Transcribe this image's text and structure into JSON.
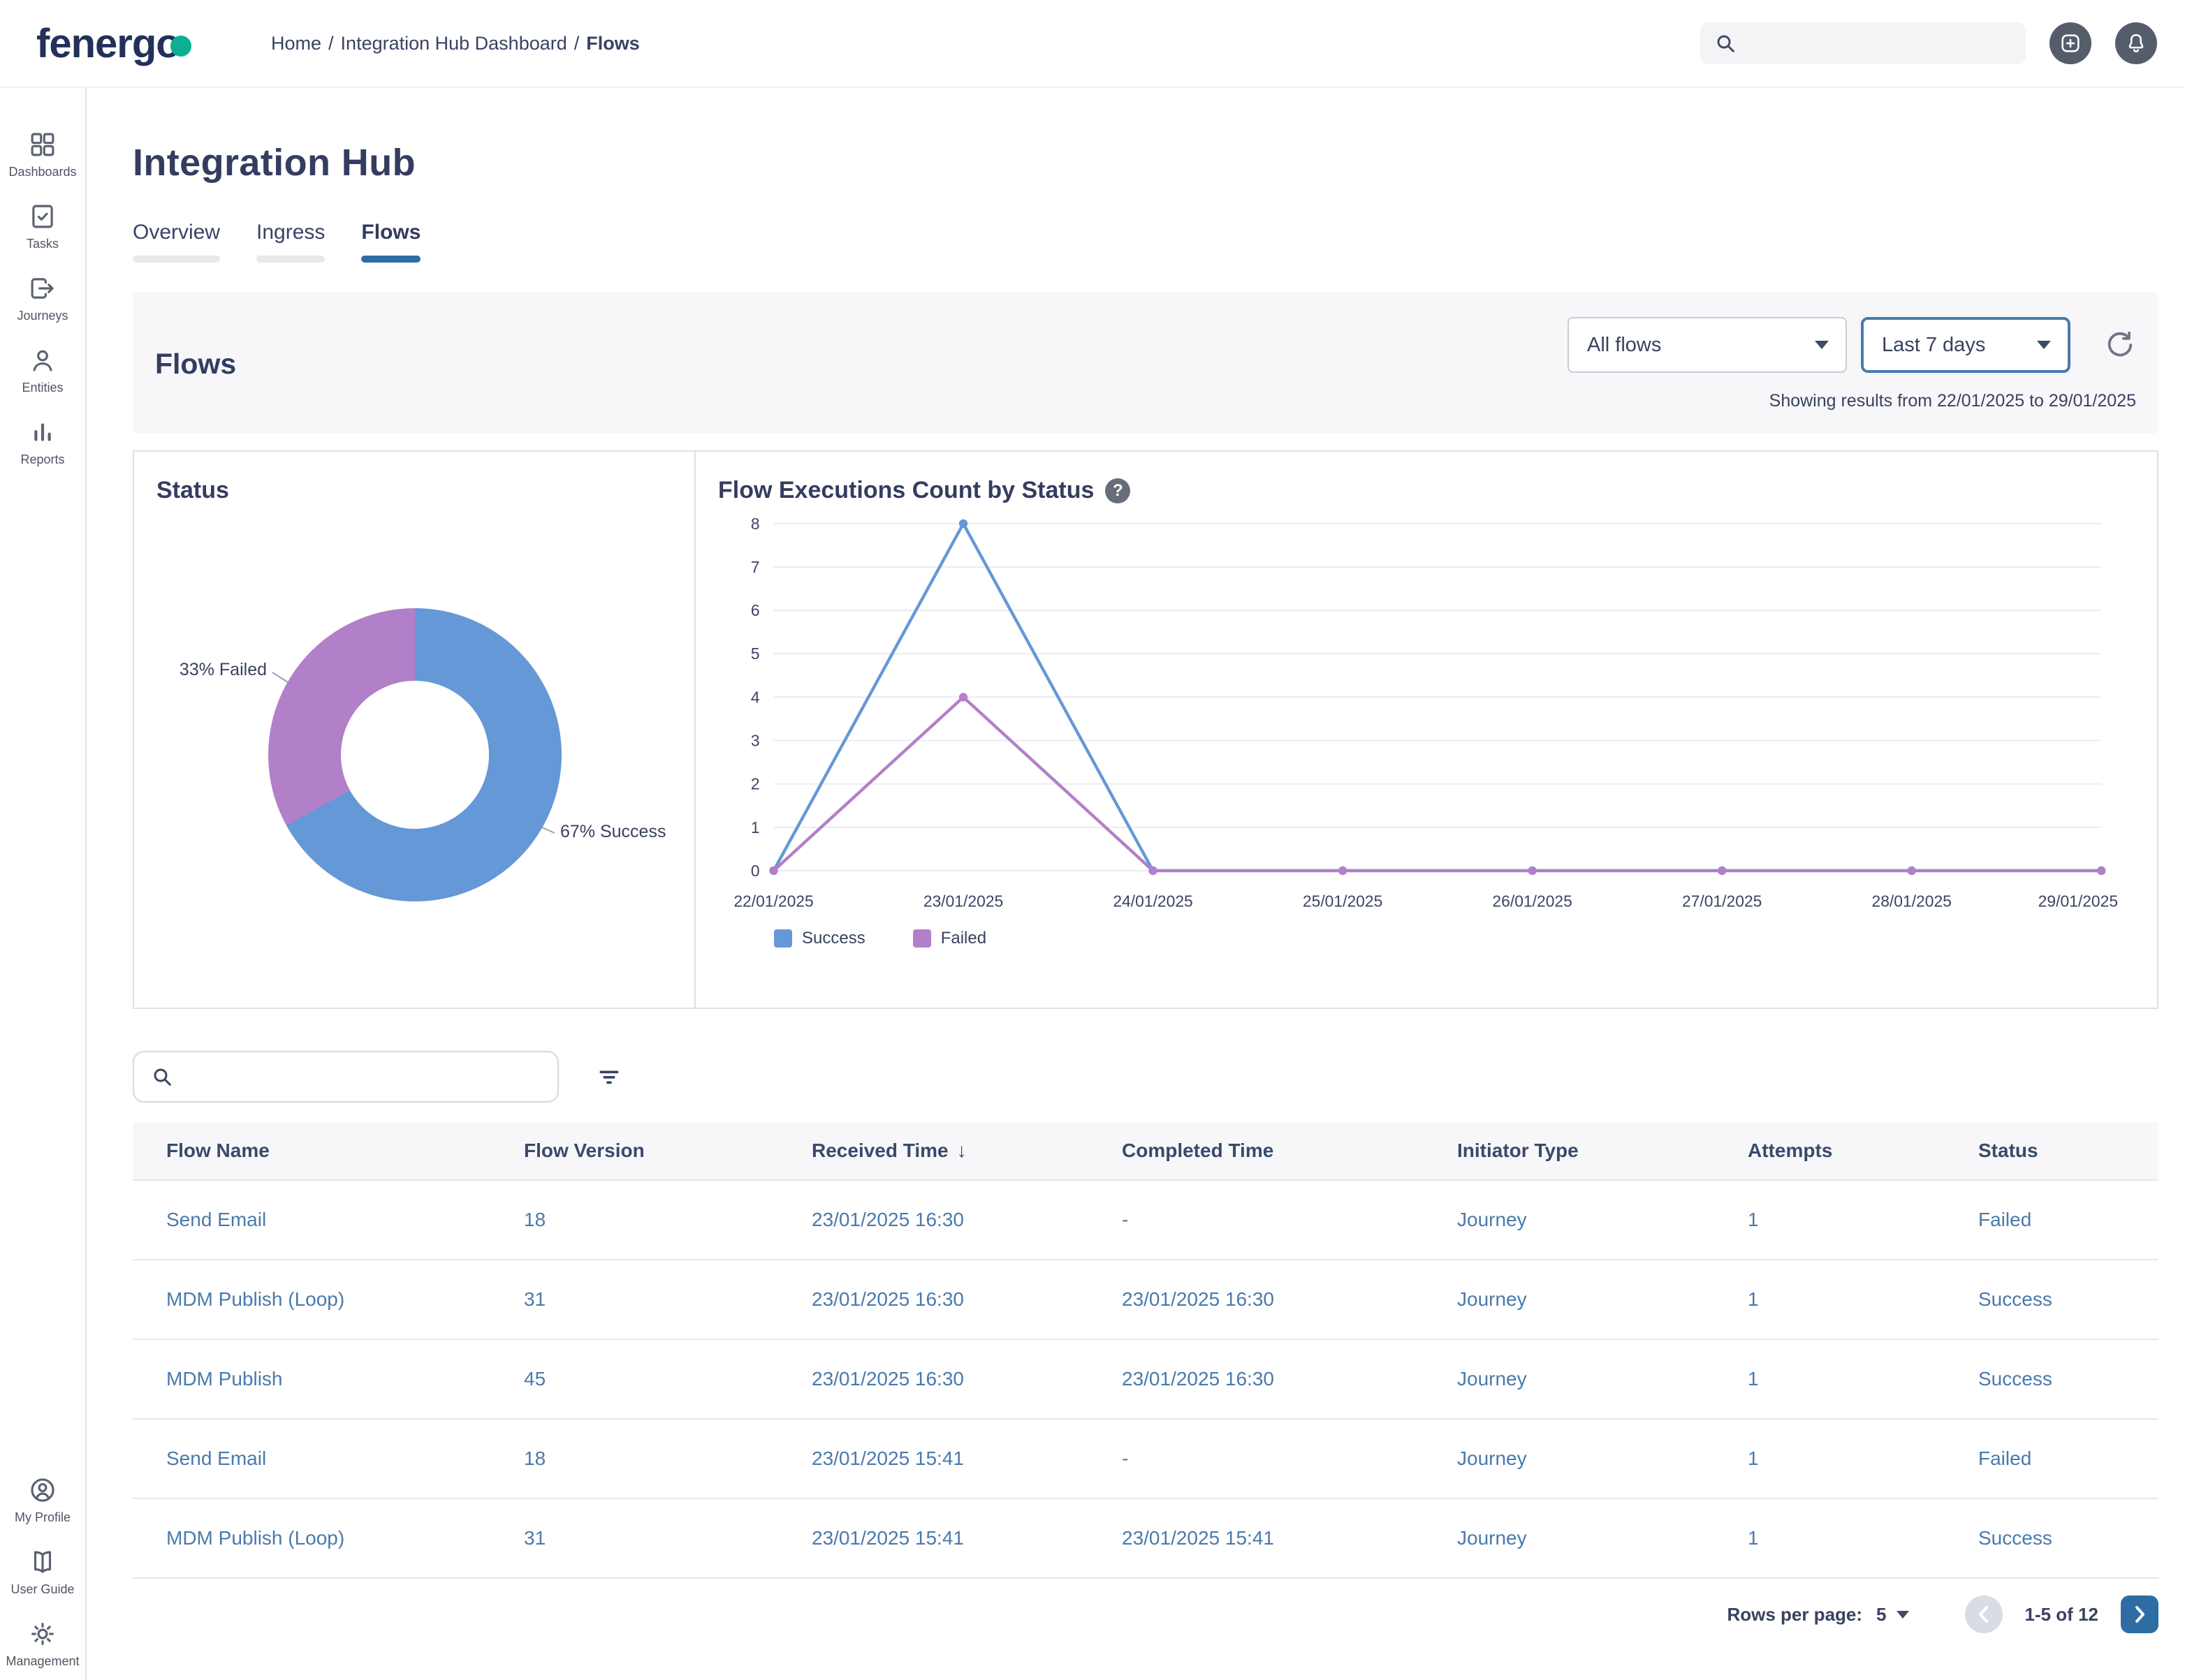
{
  "colors": {
    "accent": "#2e6ca4",
    "success": "#6598d6",
    "failed": "#b27fc9",
    "teal": "#0bb092"
  },
  "header": {
    "logo_text": "fenergo",
    "breadcrumb": {
      "items": [
        "Home",
        "Integration Hub Dashboard",
        "Flows"
      ],
      "separator": "/"
    }
  },
  "sidebar": {
    "items": [
      {
        "label": "Dashboards"
      },
      {
        "label": "Tasks"
      },
      {
        "label": "Journeys"
      },
      {
        "label": "Entities"
      },
      {
        "label": "Reports"
      }
    ],
    "bottom_items": [
      {
        "label": "My Profile"
      },
      {
        "label": "User Guide"
      },
      {
        "label": "Management"
      }
    ]
  },
  "main": {
    "title": "Integration Hub",
    "tabs": [
      {
        "label": "Overview",
        "active": false
      },
      {
        "label": "Ingress",
        "active": false
      },
      {
        "label": "Flows",
        "active": true
      }
    ],
    "flows_panel": {
      "title": "Flows",
      "flow_filter_value": "All flows",
      "range_filter_value": "Last 7 days",
      "results_text": "Showing results from 22/01/2025 to 29/01/2025"
    }
  },
  "chart_data": [
    {
      "type": "pie",
      "donut": true,
      "title": "Status",
      "labels": [
        "Success",
        "Failed"
      ],
      "values": [
        67,
        33
      ],
      "colors": [
        "#6598d6",
        "#b27fc9"
      ],
      "annotations": [
        "33% Failed",
        "67% Success"
      ]
    },
    {
      "type": "line",
      "title": "Flow Executions Count by Status",
      "x": [
        "22/01/2025",
        "23/01/2025",
        "24/01/2025",
        "25/01/2025",
        "26/01/2025",
        "27/01/2025",
        "28/01/2025",
        "29/01/2025"
      ],
      "series": [
        {
          "name": "Success",
          "color": "#6598d6",
          "values": [
            0,
            8,
            0,
            0,
            0,
            0,
            0,
            0
          ]
        },
        {
          "name": "Failed",
          "color": "#b27fc9",
          "values": [
            0,
            4,
            0,
            0,
            0,
            0,
            0,
            0
          ]
        }
      ],
      "ylim": [
        0,
        8
      ],
      "yticks": [
        0,
        1,
        2,
        3,
        4,
        5,
        6,
        7,
        8
      ],
      "grid": true,
      "legend_position": "bottom"
    }
  ],
  "table": {
    "columns": [
      "Flow Name",
      "Flow Version",
      "Received Time",
      "Completed Time",
      "Initiator Type",
      "Attempts",
      "Status"
    ],
    "sorted_by": "Received Time",
    "sort_direction": "desc",
    "rows": [
      {
        "flow_name": "Send Email",
        "flow_version": "18",
        "received_time": "23/01/2025 16:30",
        "completed_time": "-",
        "initiator_type": "Journey",
        "attempts": "1",
        "status": "Failed"
      },
      {
        "flow_name": "MDM Publish (Loop)",
        "flow_version": "31",
        "received_time": "23/01/2025 16:30",
        "completed_time": "23/01/2025 16:30",
        "initiator_type": "Journey",
        "attempts": "1",
        "status": "Success"
      },
      {
        "flow_name": "MDM Publish",
        "flow_version": "45",
        "received_time": "23/01/2025 16:30",
        "completed_time": "23/01/2025 16:30",
        "initiator_type": "Journey",
        "attempts": "1",
        "status": "Success"
      },
      {
        "flow_name": "Send Email",
        "flow_version": "18",
        "received_time": "23/01/2025 15:41",
        "completed_time": "-",
        "initiator_type": "Journey",
        "attempts": "1",
        "status": "Failed"
      },
      {
        "flow_name": "MDM Publish (Loop)",
        "flow_version": "31",
        "received_time": "23/01/2025 15:41",
        "completed_time": "23/01/2025 15:41",
        "initiator_type": "Journey",
        "attempts": "1",
        "status": "Success"
      }
    ]
  },
  "pagination": {
    "rows_per_page_label": "Rows per page:",
    "rows_per_page": "5",
    "range": "1-5 of 12"
  }
}
